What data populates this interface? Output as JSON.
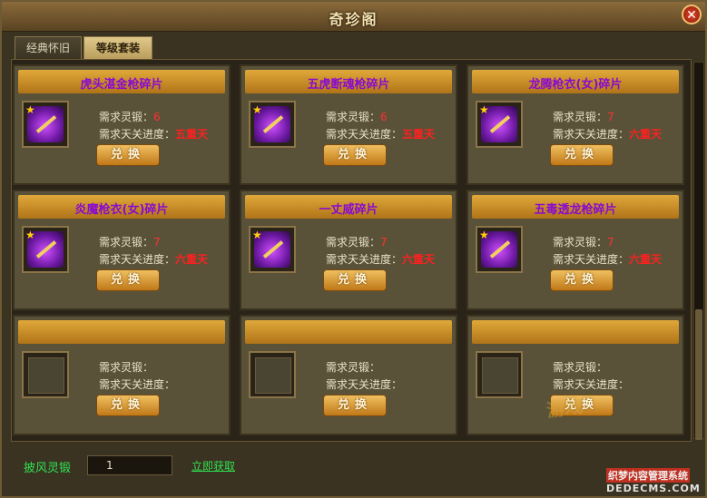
{
  "window": {
    "title": "奇珍阁",
    "close_symbol": "✕"
  },
  "tabs": [
    {
      "label": "经典怀旧",
      "active": false
    },
    {
      "label": "等级套装",
      "active": true
    }
  ],
  "cards": [
    {
      "name": "虎头湛金枪碎片",
      "req_level_label": "需求灵锻：",
      "req_level": "6",
      "req_stage_label": "需求天关进度：",
      "req_stage": "五重天",
      "button": "兑换",
      "has_item": true
    },
    {
      "name": "五虎断魂枪碎片",
      "req_level_label": "需求灵锻：",
      "req_level": "6",
      "req_stage_label": "需求天关进度：",
      "req_stage": "五重天",
      "button": "兑换",
      "has_item": true
    },
    {
      "name": "龙腾枪衣(女)碎片",
      "req_level_label": "需求灵锻：",
      "req_level": "7",
      "req_stage_label": "需求天关进度：",
      "req_stage": "六重天",
      "button": "兑换",
      "has_item": true
    },
    {
      "name": "炎魔枪衣(女)碎片",
      "req_level_label": "需求灵锻：",
      "req_level": "7",
      "req_stage_label": "需求天关进度：",
      "req_stage": "六重天",
      "button": "兑换",
      "has_item": true
    },
    {
      "name": "一丈威碎片",
      "req_level_label": "需求灵锻：",
      "req_level": "7",
      "req_stage_label": "需求天关进度：",
      "req_stage": "六重天",
      "button": "兑换",
      "has_item": true
    },
    {
      "name": "五毒透龙枪碎片",
      "req_level_label": "需求灵锻：",
      "req_level": "7",
      "req_stage_label": "需求天关进度：",
      "req_stage": "六重天",
      "button": "兑换",
      "has_item": true
    },
    {
      "name": "",
      "req_level_label": "需求灵锻：",
      "req_level": "",
      "req_stage_label": "需求天关进度：",
      "req_stage": "",
      "button": "兑换",
      "has_item": false
    },
    {
      "name": "",
      "req_level_label": "需求灵锻：",
      "req_level": "",
      "req_stage_label": "需求天关进度：",
      "req_stage": "",
      "button": "兑换",
      "has_item": false
    },
    {
      "name": "",
      "req_level_label": "需求灵锻：",
      "req_level": "",
      "req_stage_label": "需求天关进度：",
      "req_stage": "",
      "button": "兑换",
      "has_item": false
    }
  ],
  "bottom": {
    "label": "披风灵锻",
    "value": "1",
    "link": "立即获取"
  },
  "watermarks": {
    "w1": "游戏",
    "w2": "织梦内容管理系统",
    "w3": "DEDECMS.COM"
  },
  "colors": {
    "item_name": "#8a0ad0",
    "requirement_value": "#ff2020",
    "green_text": "#30e050"
  }
}
